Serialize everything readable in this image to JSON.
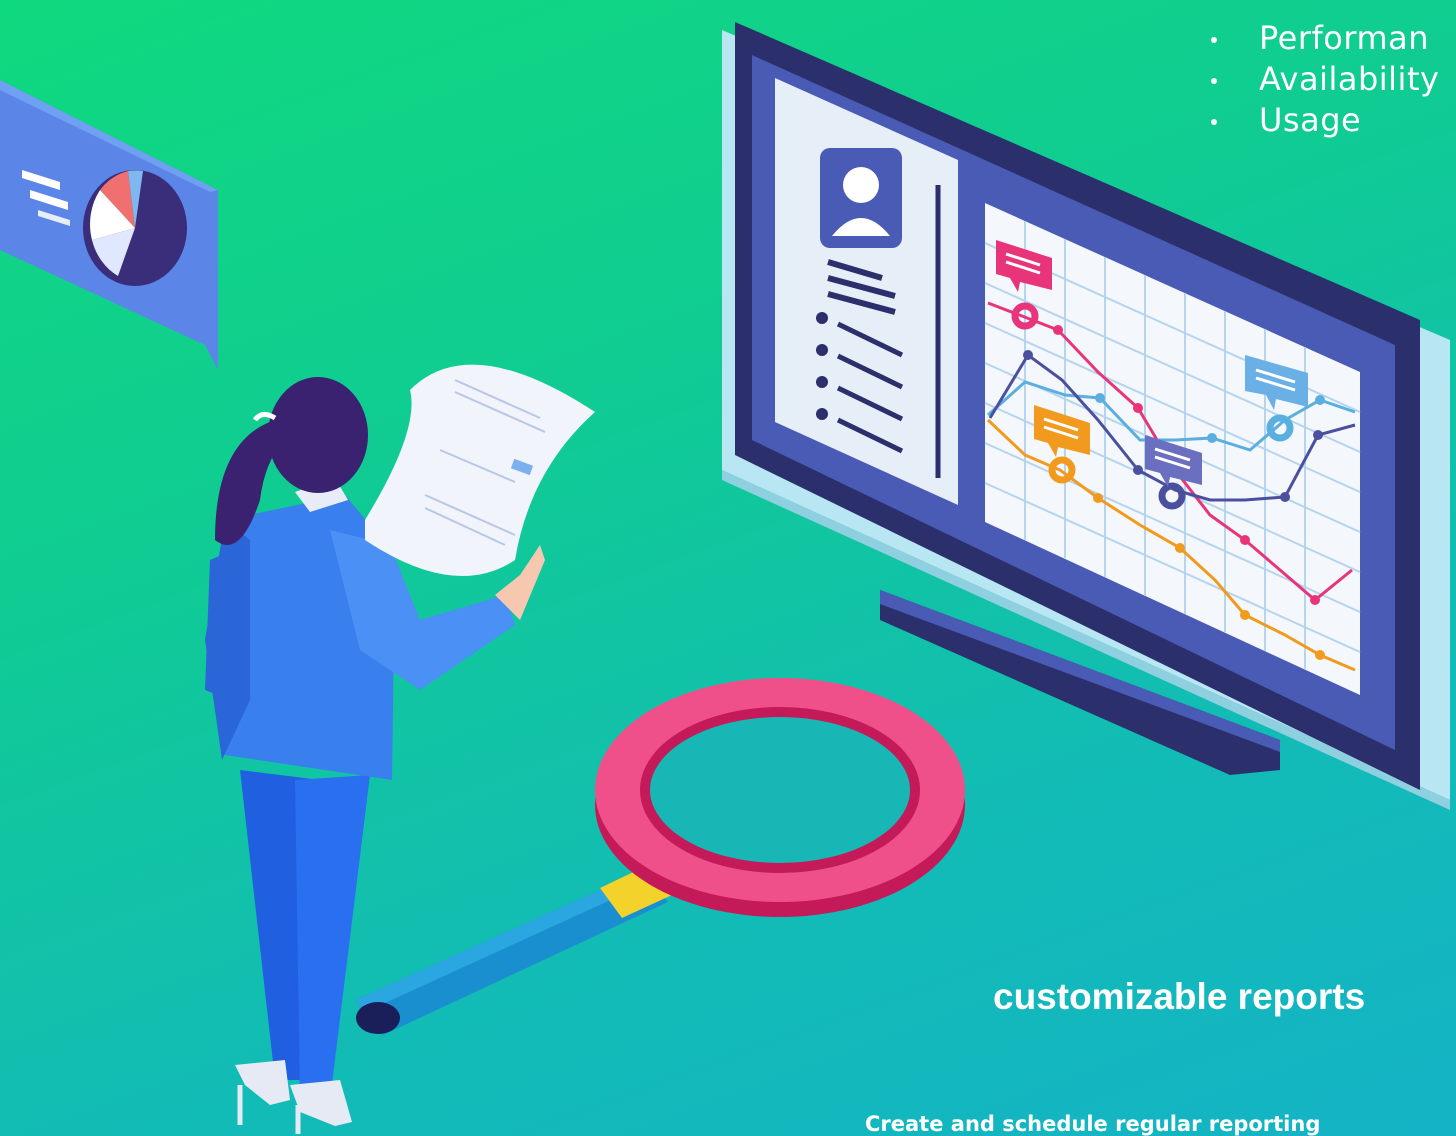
{
  "feature_list": {
    "items": [
      "Performan",
      "Availability",
      "Usage"
    ]
  },
  "headline": "customizable reports",
  "subheadline": "Create and schedule regular reporting",
  "illustration": {
    "colors": {
      "background_start": "#0fd97e",
      "background_end": "#14b3c6",
      "monitor_frame": "#2b2f6b",
      "screen_panel": "#4a5bb5",
      "line_pink": "#e8357a",
      "line_orange": "#f29a1d",
      "line_blue": "#5aaee0",
      "line_navy": "#4a4f9e",
      "magnifier_ring": "#f0508a",
      "magnifier_handle": "#2aa7e0"
    },
    "icons": [
      "pie-chart-icon",
      "user-avatar-icon",
      "message-bubble-icon",
      "magnifier-icon"
    ]
  }
}
